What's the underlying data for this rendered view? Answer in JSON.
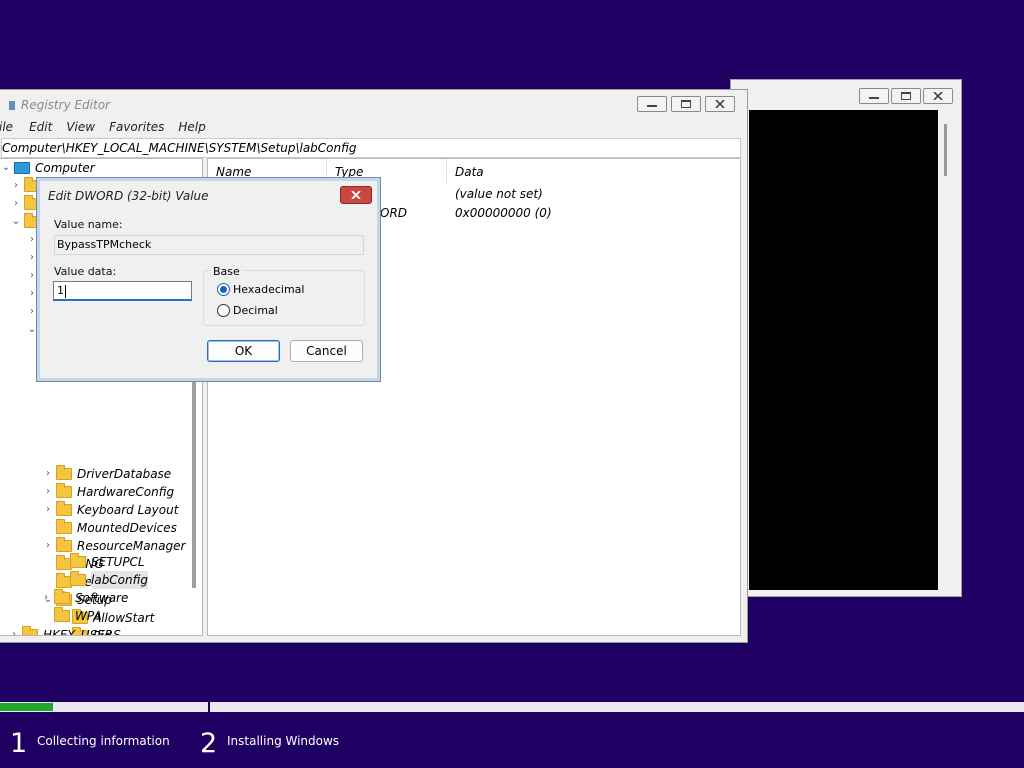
{
  "console_window": {},
  "regedit": {
    "title": "Registry Editor",
    "menu": [
      "ile",
      "Edit",
      "View",
      "Favorites",
      "Help"
    ],
    "address": "Computer\\HKEY_LOCAL_MACHINE\\SYSTEM\\Setup\\labConfig",
    "tree": {
      "root": "Computer",
      "items": [
        {
          "label": "DriverDatabase"
        },
        {
          "label": "HardwareConfig"
        },
        {
          "label": "Keyboard Layout"
        },
        {
          "label": "MountedDevices"
        },
        {
          "label": "ResourceManager"
        },
        {
          "label": "RNG"
        },
        {
          "label": "Select"
        },
        {
          "label": "Setup"
        },
        {
          "label": "AllowStart"
        },
        {
          "label": "Pid"
        },
        {
          "label": "SETUPCL"
        },
        {
          "label": "labConfig"
        },
        {
          "label": "Software"
        },
        {
          "label": "WPA"
        },
        {
          "label": "HKEY_USERS"
        }
      ]
    },
    "list": {
      "headers": {
        "name": "Name",
        "type": "Type",
        "data": "Data"
      },
      "rows": [
        {
          "type": "",
          "data": "(value not set)"
        },
        {
          "type": "ORD",
          "data": "0x00000000 (0)"
        }
      ]
    }
  },
  "dialog": {
    "title": "Edit DWORD (32-bit) Value",
    "value_name_label": "Value name:",
    "value_name": "BypassTPMcheck",
    "value_data_label": "Value data:",
    "value_data": "1",
    "base_label": "Base",
    "hex_label": "Hexadecimal",
    "dec_label": "Decimal",
    "selected_base": "Hexadecimal",
    "ok_label": "OK",
    "cancel_label": "Cancel"
  },
  "setup": {
    "progress_fraction": 0.052,
    "progress_color": "#21a52a",
    "steps": [
      {
        "num": "1",
        "label": "Collecting information"
      },
      {
        "num": "2",
        "label": "Installing Windows"
      }
    ]
  },
  "colors": {
    "desktop": "#1f0062",
    "close_button": "#c9473c",
    "accent": "#2a6bc4"
  }
}
